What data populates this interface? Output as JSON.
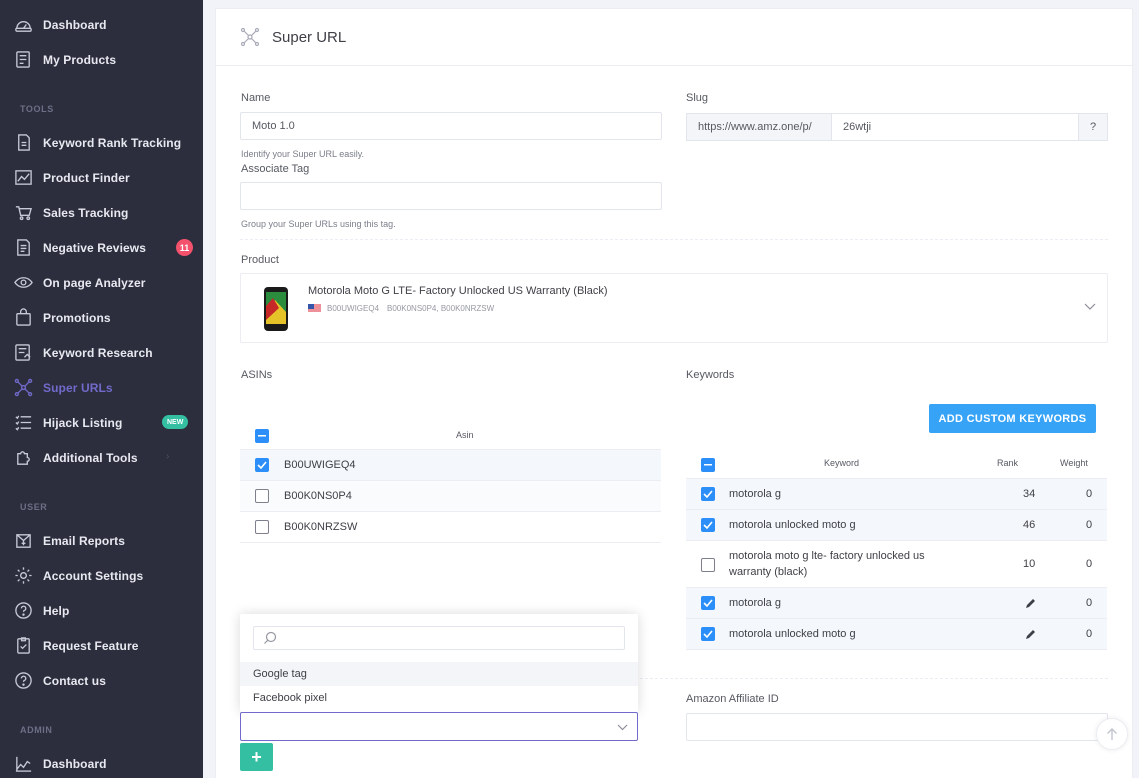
{
  "sidebar": {
    "top_items": [
      {
        "label": "Dashboard",
        "icon": "dashboard-icon"
      },
      {
        "label": "My Products",
        "icon": "products-icon"
      }
    ],
    "tools_label": "TOOLS",
    "tools": [
      {
        "label": "Keyword Rank Tracking",
        "icon": "rank-tracking-icon"
      },
      {
        "label": "Product Finder",
        "icon": "product-finder-icon"
      },
      {
        "label": "Sales Tracking",
        "icon": "sales-tracking-icon"
      },
      {
        "label": "Negative Reviews",
        "icon": "negative-reviews-icon",
        "badge": "11"
      },
      {
        "label": "On page Analyzer",
        "icon": "eye-icon"
      },
      {
        "label": "Promotions",
        "icon": "bag-icon"
      },
      {
        "label": "Keyword Research",
        "icon": "keyword-research-icon"
      },
      {
        "label": "Super URLs",
        "icon": "super-url-icon",
        "active": true
      },
      {
        "label": "Hijack Listing",
        "icon": "hijack-icon",
        "badge": "NEW"
      },
      {
        "label": "Additional Tools",
        "icon": "puzzle-icon"
      }
    ],
    "user_label": "USER",
    "user": [
      {
        "label": "Email Reports",
        "icon": "email-reports-icon"
      },
      {
        "label": "Account Settings",
        "icon": "gear-icon"
      },
      {
        "label": "Help",
        "icon": "help-icon"
      },
      {
        "label": "Request Feature",
        "icon": "request-feature-icon"
      },
      {
        "label": "Contact us",
        "icon": "contact-icon"
      }
    ],
    "admin_label": "ADMIN",
    "admin": [
      {
        "label": "Dashboard",
        "icon": "admin-dashboard-icon"
      }
    ]
  },
  "header": {
    "title": "Super URL"
  },
  "form": {
    "name_label": "Name",
    "name_value": "Moto 1.0",
    "name_help": "Identify your Super URL easily.",
    "slug_label": "Slug",
    "slug_prefix": "https://www.amz.one/p/",
    "slug_value": "26wtji",
    "slug_help_btn": "?",
    "assoc_label": "Associate Tag",
    "assoc_value": "",
    "assoc_help": "Group your Super URLs using this tag.",
    "product_label": "Product",
    "product_title": "Motorola Moto G LTE- Factory Unlocked US Warranty (Black)",
    "product_asin": "B00UWIGEQ4",
    "product_variants": "B00K0NS0P4, B00K0NRZSW",
    "asins_label": "ASINs",
    "keywords_label": "Keywords",
    "affiliate_label": "Amazon Affiliate ID",
    "affiliate_value": ""
  },
  "asins": {
    "header": "Asin",
    "rows": [
      {
        "asin": "B00UWIGEQ4",
        "checked": true
      },
      {
        "asin": "B00K0NS0P4",
        "checked": false
      },
      {
        "asin": "B00K0NRZSW",
        "checked": false
      }
    ]
  },
  "keywords": {
    "add_button": "ADD CUSTOM KEYWORDS",
    "headers": {
      "keyword": "Keyword",
      "rank": "Rank",
      "weight": "Weight"
    },
    "rows": [
      {
        "keyword": "motorola g",
        "rank": "34",
        "weight": "0",
        "checked": true
      },
      {
        "keyword": "motorola unlocked moto g",
        "rank": "46",
        "weight": "0",
        "checked": true
      },
      {
        "keyword": "motorola moto g lte- factory unlocked us",
        "keyword2": "warranty (black)",
        "rank": "10",
        "weight": "0",
        "checked": false
      },
      {
        "keyword": "motorola g",
        "rank": "",
        "weight": "0",
        "checked": true,
        "edit": true
      },
      {
        "keyword": "motorola unlocked moto g",
        "rank": "",
        "weight": "0",
        "checked": true,
        "edit": true
      }
    ]
  },
  "pixel_dropdown": {
    "search_placeholder": "",
    "options": [
      "Google tag",
      "Facebook pixel"
    ],
    "selected": "",
    "add_button": "+"
  },
  "colors": {
    "sidebar_bg": "#2c2e3e",
    "active": "#716aca",
    "primary": "#36a3f7",
    "success": "#34bfa3",
    "danger": "#f4516c"
  }
}
